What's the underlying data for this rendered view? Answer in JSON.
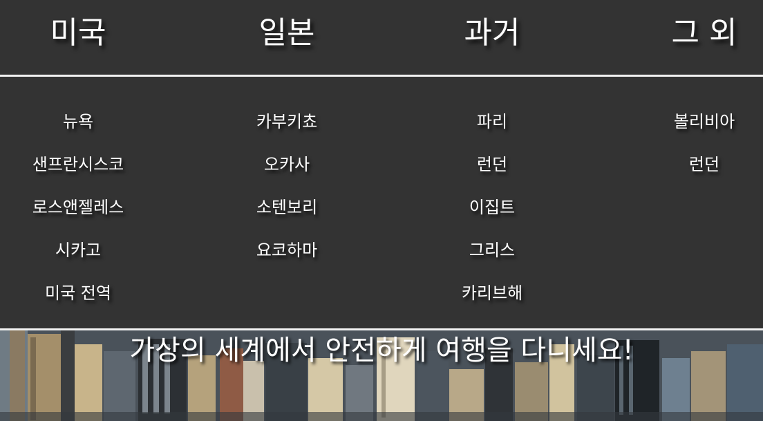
{
  "nav": {
    "categories": [
      {
        "label": "미국",
        "items": [
          "뉴욕",
          "샌프란시스코",
          "로스앤젤레스",
          "시카고",
          "미국 전역"
        ]
      },
      {
        "label": "일본",
        "items": [
          "카부키쵸",
          "오카사",
          "소텐보리",
          "요코하마"
        ]
      },
      {
        "label": "과거",
        "items": [
          "파리",
          "런던",
          "이집트",
          "그리스",
          "카리브해"
        ]
      },
      {
        "label": "그 외",
        "items": [
          "볼리비아",
          "런던"
        ]
      }
    ]
  },
  "hero": {
    "tagline": "가상의 세계에서 안전하게 여행을 다니세요!",
    "image": "city-skyline-aerial-photo"
  },
  "colors": {
    "background": "#333333",
    "divider": "#f2f2f2",
    "text": "#ffffff"
  }
}
